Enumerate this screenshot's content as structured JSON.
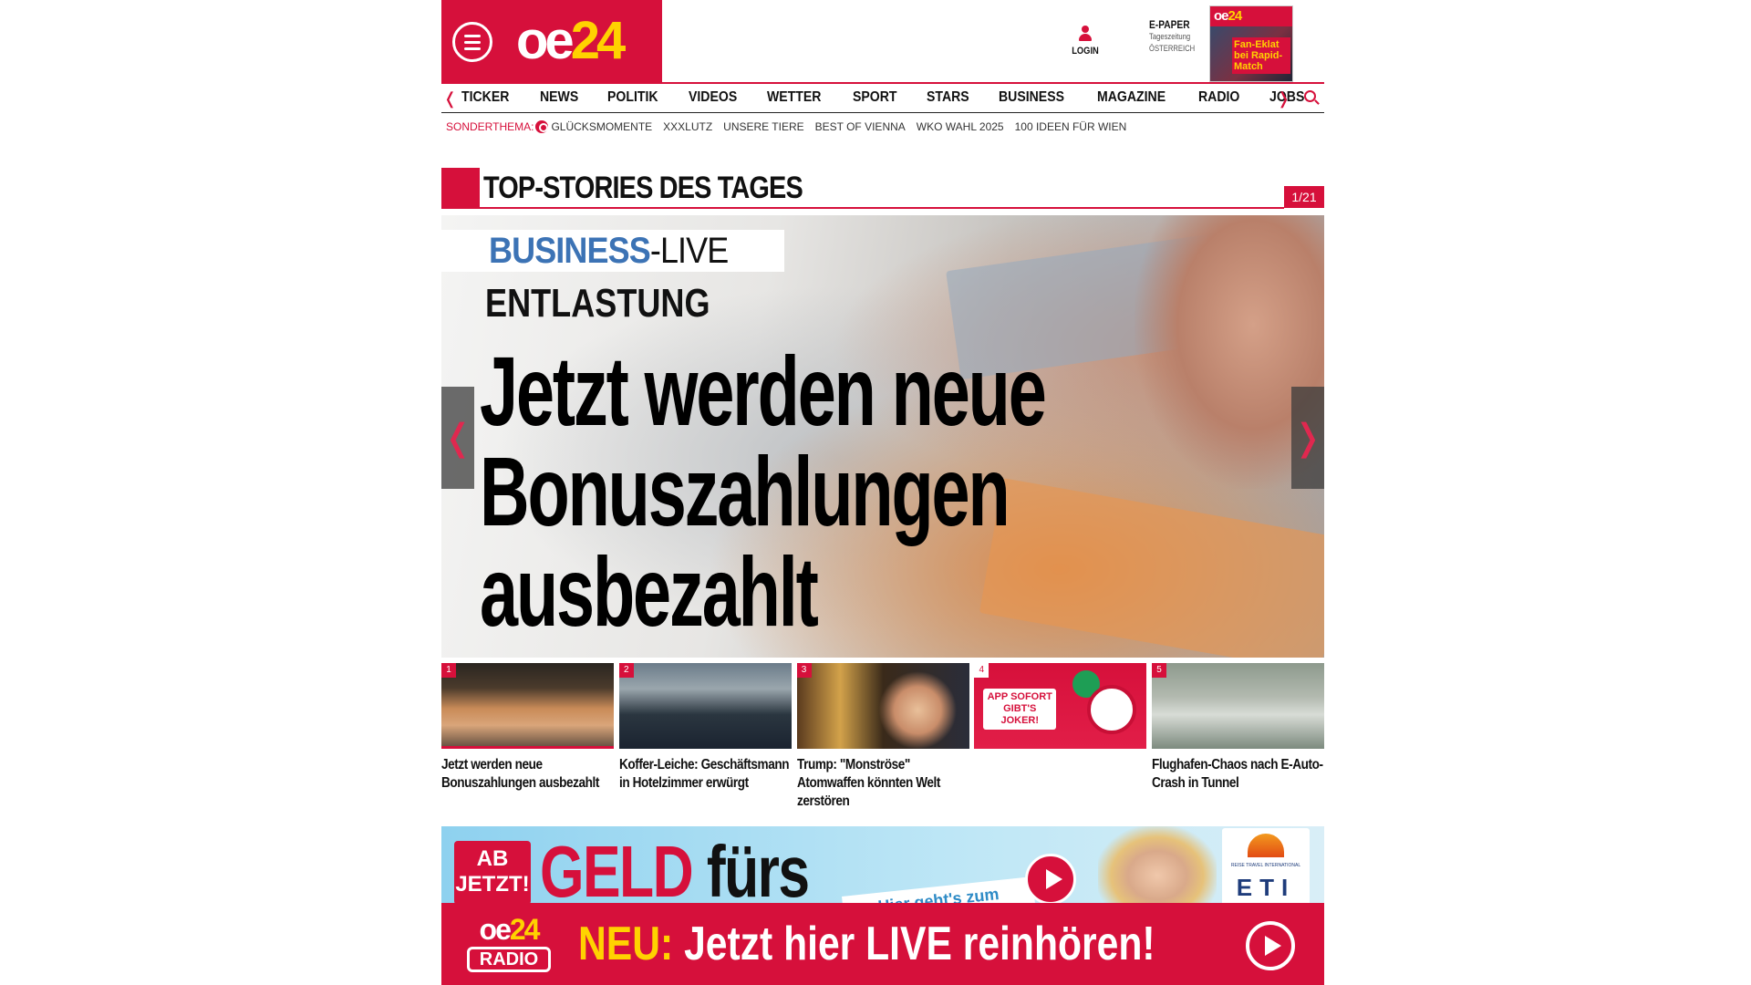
{
  "header": {
    "logo_main": "oe",
    "logo_accent": "24",
    "login_label": "LOGIN",
    "epaper": {
      "title": "E-PAPER",
      "subtitle": "Tageszeitung",
      "region": "ÖSTERREICH",
      "cover_logo": "oe",
      "cover_logo_accent": "24",
      "cover_headline": "Fan-Eklat bei Rapid-Match"
    }
  },
  "nav": {
    "items": [
      "TICKER",
      "NEWS",
      "POLITIK",
      "VIDEOS",
      "WETTER",
      "SPORT",
      "STARS",
      "BUSINESS",
      "MAGAZINE",
      "RADIO",
      "JOBS"
    ],
    "prev_glyph": "❬",
    "next_glyph": "❭"
  },
  "subnav": {
    "label": "SONDERTHEMA:",
    "items": [
      "GLÜCKSMOMENTE",
      "XXXLUTZ",
      "UNSERE TIERE",
      "BEST OF VIENNA",
      "WKO WAHL 2025",
      "100 IDEEN FÜR WIEN"
    ]
  },
  "section": {
    "title": "TOP-STORIES DES TAGES",
    "counter": "1/21"
  },
  "hero": {
    "badge_primary": "BUSINESS",
    "badge_secondary": "-LIVE",
    "kicker": "ENTLASTUNG",
    "headline_lines": [
      "Jetzt werden neue",
      "Bonuszahlungen",
      "ausbezahlt"
    ],
    "prev_glyph": "❬",
    "next_glyph": "❭"
  },
  "thumbs": [
    {
      "num": "1",
      "caption": "Jetzt werden neue Bonuszahlungen ausbezahlt"
    },
    {
      "num": "2",
      "caption": "Koffer-Leiche: Geschäftsmann in Hotelzimmer erwürgt"
    },
    {
      "num": "3",
      "caption": "Trump: \"Monströse\" Atomwaffen könnten Welt zerstören"
    },
    {
      "num": "4",
      "caption": "",
      "ad_text": "APP SOFORT GIBT'S JOKER!"
    },
    {
      "num": "5",
      "caption": "Flughafen-Chaos nach E-Auto-Crash in Tunnel"
    }
  ],
  "ad": {
    "badge": "AB JETZT!",
    "headline_red": "GELD",
    "headline_dark": " fürs",
    "cta": "Hier geht's zum",
    "brand": "ETI",
    "brand_sub": "REISE TRAVEL INTERNATIONAL"
  },
  "radio": {
    "logo_main": "oe",
    "logo_accent": "24",
    "logo_sub": "RADIO",
    "prefix": "NEU:",
    "text": " Jetzt hier LIVE reinhören!"
  },
  "colors": {
    "brand_red": "#d6103b",
    "brand_yellow": "#ffd200",
    "business_blue": "#3c73b5"
  }
}
